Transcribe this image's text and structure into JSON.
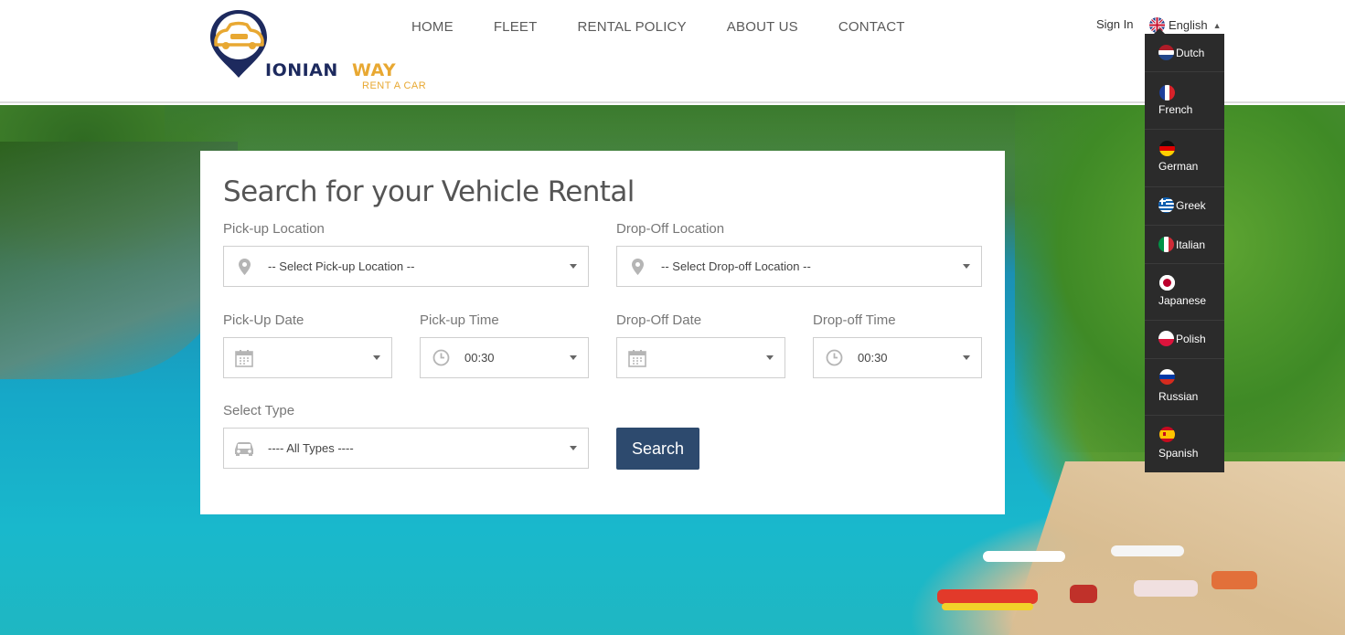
{
  "brand": {
    "name_part1": "IONIAN",
    "name_part2": "WAY",
    "tagline": "RENT A CAR",
    "colors": {
      "navy": "#1d2a5e",
      "gold": "#e8a832"
    }
  },
  "nav": {
    "items": [
      {
        "label": "HOME"
      },
      {
        "label": "FLEET"
      },
      {
        "label": "RENTAL POLICY"
      },
      {
        "label": "ABOUT US"
      },
      {
        "label": "CONTACT"
      }
    ]
  },
  "header": {
    "signin_label": "Sign In",
    "language_current": "English"
  },
  "languages": [
    {
      "label": "Dutch",
      "icon": "flag-netherlands-icon",
      "layout": "inline"
    },
    {
      "label": "French",
      "icon": "flag-france-icon",
      "layout": "below"
    },
    {
      "label": "German",
      "icon": "flag-germany-icon",
      "layout": "below"
    },
    {
      "label": "Greek",
      "icon": "flag-greece-icon",
      "layout": "inline"
    },
    {
      "label": "Italian",
      "icon": "flag-italy-icon",
      "layout": "inline"
    },
    {
      "label": "Japanese",
      "icon": "flag-japan-icon",
      "layout": "below"
    },
    {
      "label": "Polish",
      "icon": "flag-poland-icon",
      "layout": "inline"
    },
    {
      "label": "Russian",
      "icon": "flag-russia-icon",
      "layout": "below"
    },
    {
      "label": "Spanish",
      "icon": "flag-spain-icon",
      "layout": "below"
    }
  ],
  "search": {
    "title": "Search for your Vehicle Rental",
    "pickup_location": {
      "label": "Pick-up Location",
      "value": "-- Select Pick-up Location --",
      "icon": "map-marker-icon"
    },
    "dropoff_location": {
      "label": "Drop-Off Location",
      "value": "-- Select Drop-off Location --",
      "icon": "map-marker-icon"
    },
    "pickup_date": {
      "label": "Pick-Up Date",
      "value": "",
      "icon": "calendar-icon"
    },
    "pickup_time": {
      "label": "Pick-up Time",
      "value": "00:30",
      "icon": "clock-icon"
    },
    "dropoff_date": {
      "label": "Drop-Off Date",
      "value": "",
      "icon": "calendar-icon"
    },
    "dropoff_time": {
      "label": "Drop-off Time",
      "value": "00:30",
      "icon": "clock-icon"
    },
    "vehicle_type": {
      "label": "Select Type",
      "value": "---- All Types ----",
      "icon": "car-icon"
    },
    "button_label": "Search",
    "button_color": "#2d4a6e"
  }
}
